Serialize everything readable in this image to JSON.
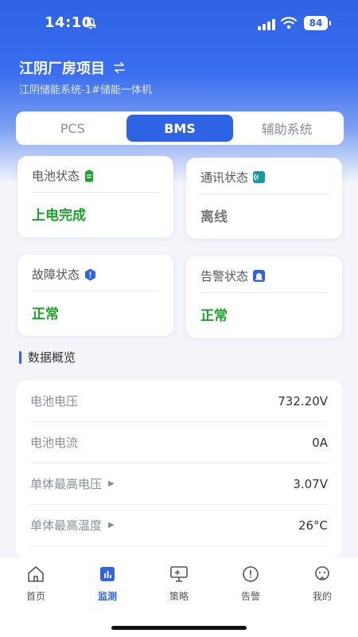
{
  "status_bar": {
    "time": "14:10",
    "battery": "84"
  },
  "header": {
    "title": "江阴厂房项目",
    "subtitle": "江阴储能系统-1#储能一体机"
  },
  "tabs": [
    {
      "label": "PCS"
    },
    {
      "label": "BMS"
    },
    {
      "label": "辅助系统"
    }
  ],
  "cards": {
    "battery": {
      "title": "电池状态",
      "value": "上电完成"
    },
    "comm": {
      "title": "通讯状态",
      "value": "离线"
    },
    "fault": {
      "title": "故障状态",
      "value": "正常"
    },
    "alarm": {
      "title": "告警状态",
      "value": "正常"
    }
  },
  "section": {
    "title": "数据概览"
  },
  "rows": [
    {
      "label": "电池电压",
      "value": "732.20V"
    },
    {
      "label": "电池电流",
      "value": "0A"
    },
    {
      "label": "单体最高电压",
      "value": "3.07V"
    },
    {
      "label": "单体最高温度",
      "value": "26°C"
    }
  ],
  "nav": [
    {
      "label": "首页"
    },
    {
      "label": "监测"
    },
    {
      "label": "策略"
    },
    {
      "label": "告警"
    },
    {
      "label": "我的"
    }
  ],
  "colors": {
    "accent": "#2f63e6",
    "ok": "#1aa52a",
    "offline": "#777777"
  }
}
